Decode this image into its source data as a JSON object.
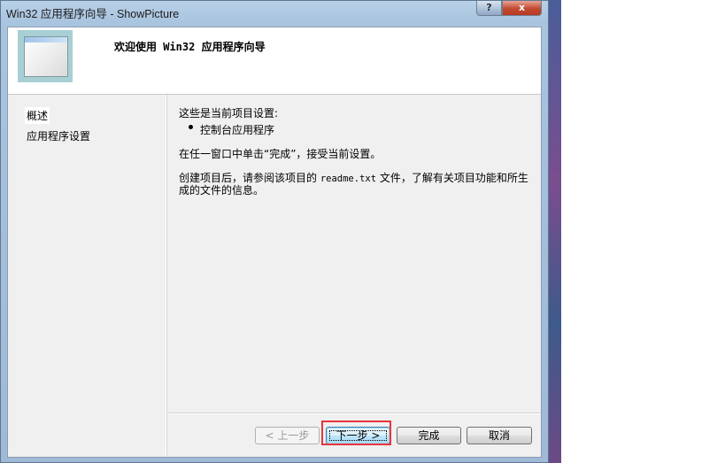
{
  "window": {
    "title": "Win32 应用程序向导 - ShowPicture",
    "help_symbol": "?",
    "close_symbol": "x"
  },
  "header": {
    "title": "欢迎使用 Win32 应用程序向导",
    "icon": "wizard-window-icon"
  },
  "sidebar": {
    "items": [
      {
        "label": "概述",
        "current": true
      },
      {
        "label": "应用程序设置",
        "current": false
      }
    ]
  },
  "content": {
    "intro": "这些是当前项目设置:",
    "bullets": [
      "控制台应用程序"
    ],
    "finish_hint": "在任一窗口中单击“完成”，接受当前设置。",
    "readme_line1_prefix": "创建项目后，请参阅该项目的 ",
    "readme_file": "readme.txt",
    "readme_line1_suffix": " 文件，了解有关项目功能和所生",
    "readme_line2": "成的文件的信息。"
  },
  "buttons": {
    "prev": "< 上一步",
    "next": "下一步 >",
    "finish": "完成",
    "cancel": "取消"
  },
  "colors": {
    "highlight_border": "#e8353b",
    "banner_bg": "#a8d0d4",
    "default_button": "#3c7fb1"
  }
}
